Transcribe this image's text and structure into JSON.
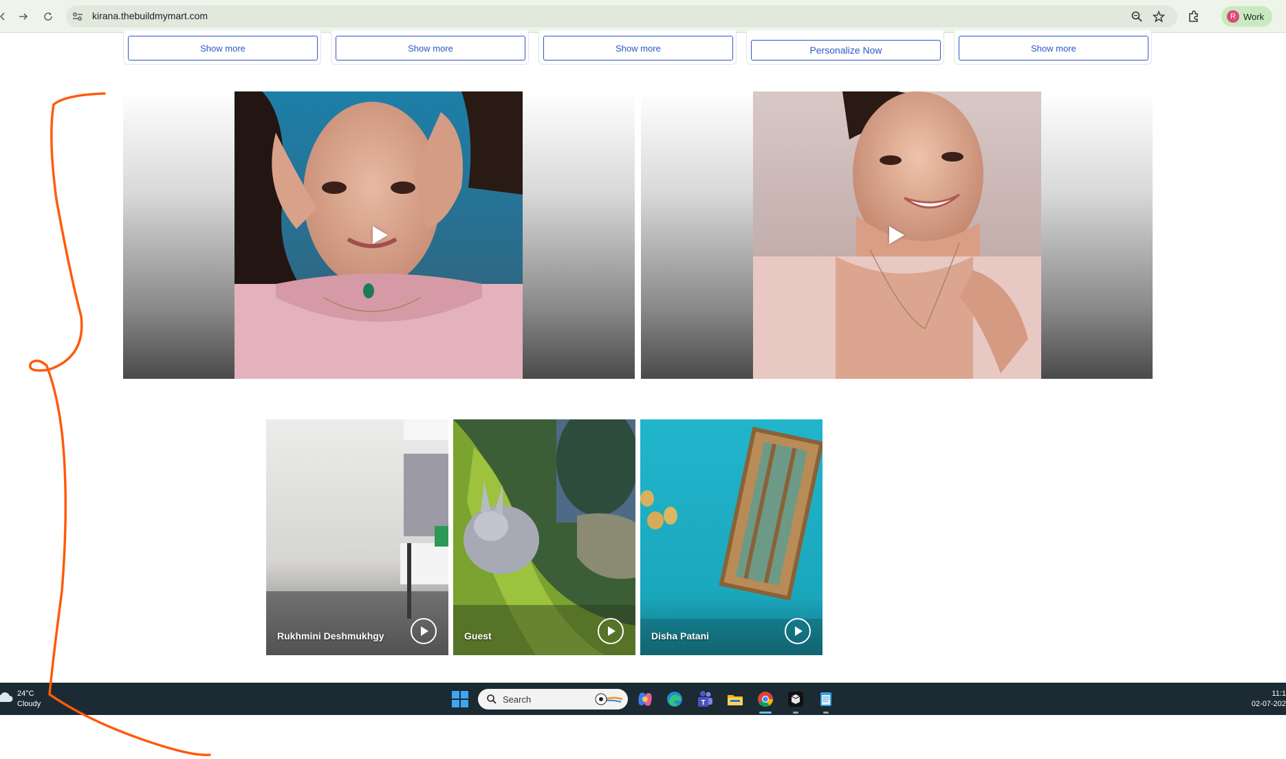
{
  "browser": {
    "url": "kirana.thebuildmymart.com",
    "profile_initial": "R",
    "profile_label": "Work",
    "icons": [
      "back-icon",
      "forward-icon",
      "reload-icon",
      "site-info-icon",
      "zoom-icon",
      "bookmark-star-icon",
      "extensions-icon"
    ]
  },
  "product_cards": [
    {
      "button_label": "Show more"
    },
    {
      "button_label": "Show more"
    },
    {
      "button_label": "Show more"
    },
    {
      "button_label": "Personalize Now"
    },
    {
      "button_label": "Show more"
    }
  ],
  "featured_videos": [
    {
      "icon": "play-icon"
    },
    {
      "icon": "play-icon"
    }
  ],
  "reels": [
    {
      "label": "Rukhmini Deshmukhgy",
      "icon": "play-circle-icon"
    },
    {
      "label": "Guest",
      "icon": "play-circle-icon"
    },
    {
      "label": "Disha Patani",
      "icon": "play-circle-icon"
    }
  ],
  "taskbar": {
    "weather_temp": "24°C",
    "weather_desc": "Cloudy",
    "search_label": "Search",
    "time": "11:1",
    "date": "02-07-202",
    "annotation_color": "#ff5a0a"
  }
}
